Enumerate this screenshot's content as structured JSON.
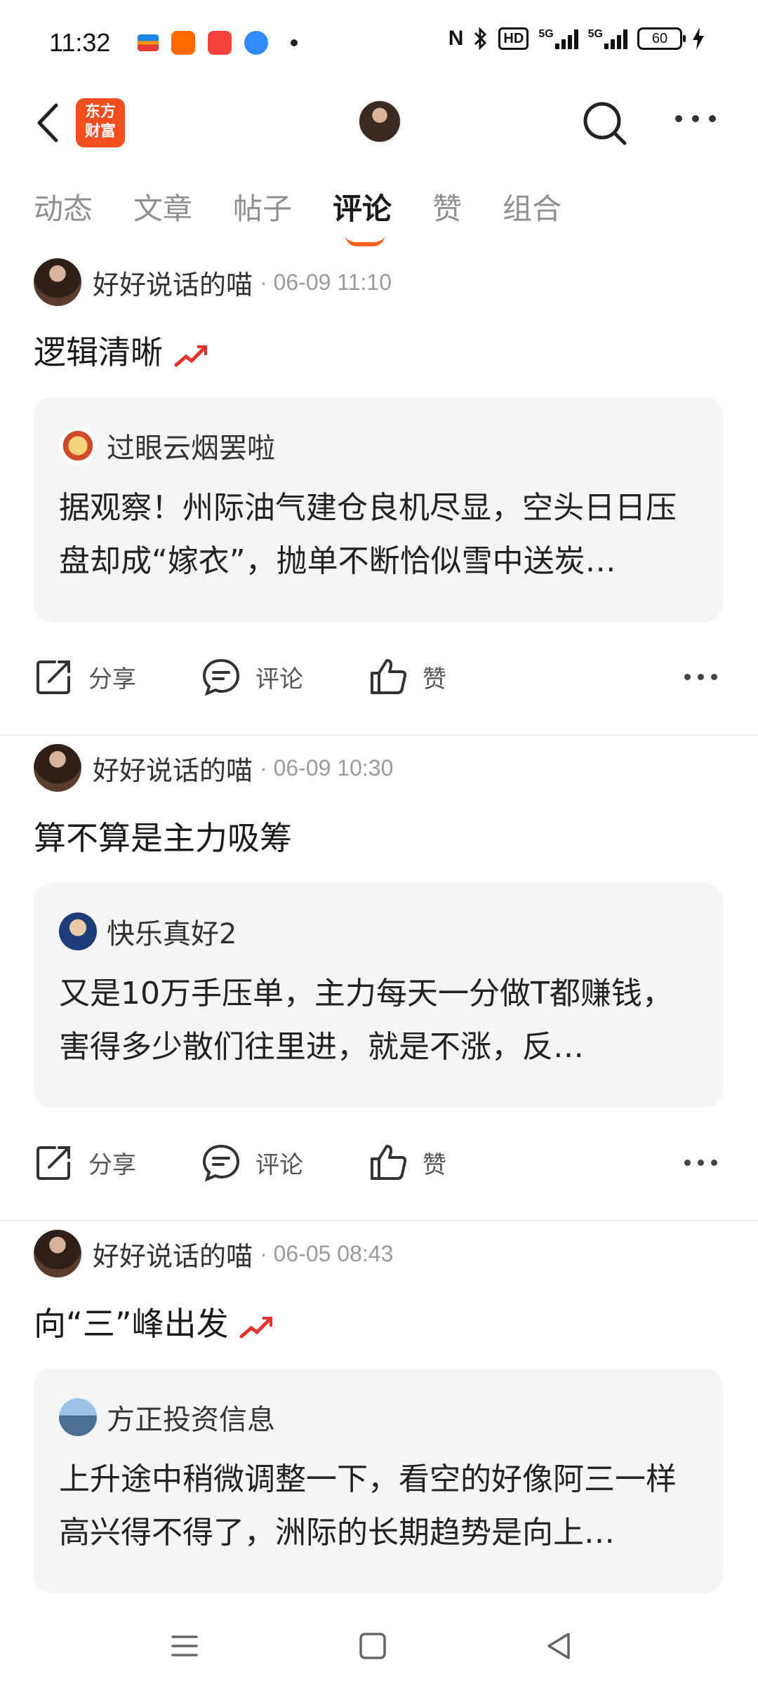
{
  "status_bar": {
    "time": "11:32",
    "hd_label": "HD",
    "network_1": "5G",
    "network_2": "5G",
    "battery": "60"
  },
  "top_nav": {
    "logo_line1": "东方",
    "logo_line2": "财富"
  },
  "tabs": [
    {
      "label": "动态"
    },
    {
      "label": "文章"
    },
    {
      "label": "帖子"
    },
    {
      "label": "评论",
      "active": true
    },
    {
      "label": "赞"
    },
    {
      "label": "组合"
    }
  ],
  "posts": [
    {
      "user": "好好说话的喵",
      "time": "· 06-09 11:10",
      "text": "逻辑清晰",
      "trend_icon": true,
      "quote": {
        "user": "过眼云烟罢啦",
        "text": "据观察！州际油气建仓良机尽显，空头日日压盘却成“嫁衣”，抛单不断恰似雪中送炭…"
      }
    },
    {
      "user": "好好说话的喵",
      "time": "· 06-09 10:30",
      "text": "算不算是主力吸筹",
      "trend_icon": false,
      "quote": {
        "user": "快乐真好2",
        "text": "又是10万手压单，主力每天一分做T都赚钱，害得多少散们往里进，就是不涨，反…"
      }
    },
    {
      "user": "好好说话的喵",
      "time": "· 06-05 08:43",
      "text": "向“三”峰出发",
      "trend_icon": true,
      "quote": {
        "user": "方正投资信息",
        "text": "上升途中稍微调整一下，看空的好像阿三一样高兴得不得了，洲际的长期趋势是向上…"
      }
    }
  ],
  "actions": {
    "share": "分享",
    "comment": "评论",
    "like": "赞"
  },
  "colors": {
    "accent": "#ff6020",
    "brand": "#f04e1e",
    "quote_bg": "#f4f5f7"
  }
}
